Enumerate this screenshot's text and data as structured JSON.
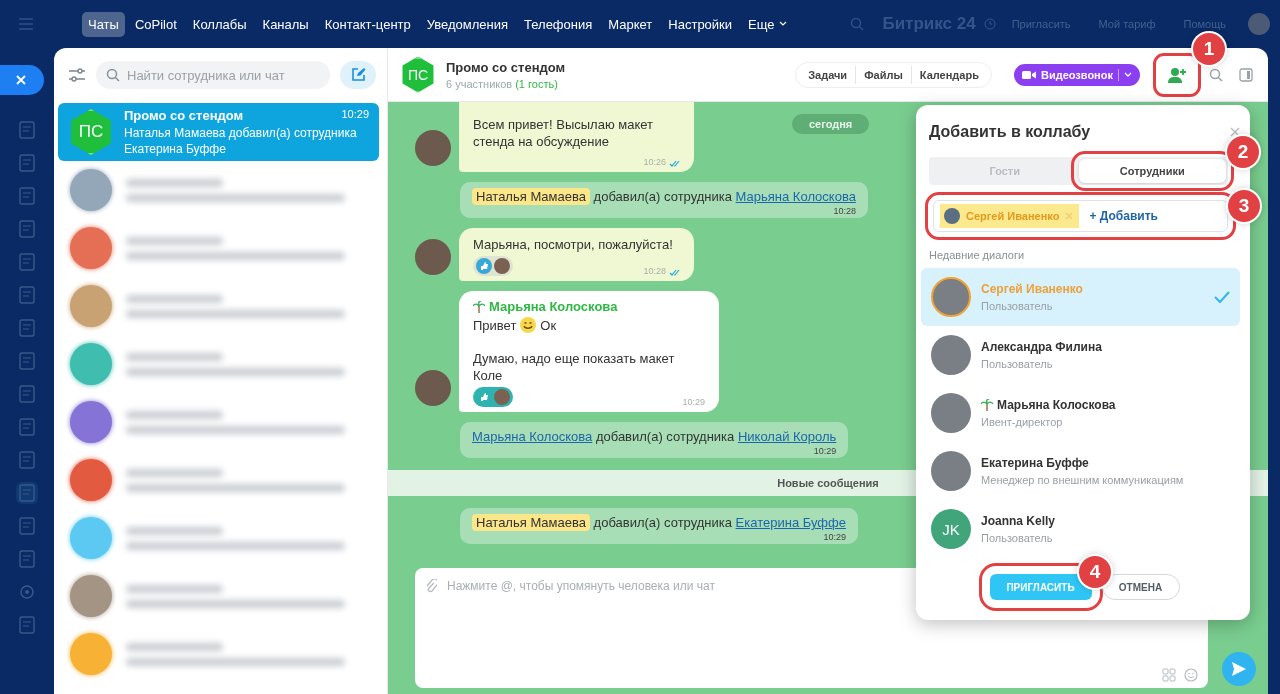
{
  "top_nav": {
    "items": [
      {
        "label": "Чаты",
        "selected": true,
        "kind": "link"
      },
      {
        "label": "CoPilot",
        "selected": false,
        "kind": "link"
      },
      {
        "label": "Коллабы",
        "selected": false,
        "kind": "link"
      },
      {
        "label": "Каналы",
        "selected": false,
        "kind": "link"
      },
      {
        "label": "Контакт-центр",
        "selected": false,
        "kind": "link"
      },
      {
        "label": "Уведомления",
        "selected": false,
        "kind": "link"
      },
      {
        "label": "Телефония",
        "selected": false,
        "kind": "link"
      },
      {
        "label": "Маркет",
        "selected": false,
        "kind": "link"
      },
      {
        "label": "Настройки",
        "selected": false,
        "kind": "link"
      },
      {
        "label": "Еще",
        "selected": false,
        "kind": "dropdown"
      }
    ],
    "brand": "Битрикс 24",
    "links": [
      "Пригласить",
      "Мой тариф",
      "Помощь"
    ]
  },
  "chat_list": {
    "search": {
      "placeholder": "Найти сотрудника или чат"
    },
    "chats": [
      {
        "kind": "chat",
        "initials": "ПС",
        "title": "Промо со стендом",
        "time": "10:29",
        "preview": "Наталья Мамаева добавил(а) сотрудника Екатерина Буффе",
        "selected": true
      },
      {
        "kind": "blurred",
        "color": "#93a7b8",
        "selected": false
      },
      {
        "kind": "blurred",
        "color": "#e46f55",
        "selected": false
      },
      {
        "kind": "blurred",
        "color": "#c9a274",
        "selected": false
      },
      {
        "kind": "blurred",
        "color": "#3fbdae",
        "selected": false
      },
      {
        "kind": "blurred",
        "color": "#8574d6",
        "selected": false
      },
      {
        "kind": "blurred",
        "color": "#e25b41",
        "selected": false
      },
      {
        "kind": "blurred",
        "color": "#5cc9f2",
        "selected": false
      },
      {
        "kind": "blurred",
        "color": "#a39484",
        "selected": false
      },
      {
        "kind": "blurred",
        "color": "#f7b236",
        "selected": false
      }
    ]
  },
  "chat": {
    "initials": "ПС",
    "title": "Промо со стендом",
    "members": "6 участников",
    "guests": "(1 гость)",
    "actions": [
      "Задачи",
      "Файлы",
      "Календарь"
    ],
    "call_button": "Видеозвонок",
    "date_pill": "сегодня",
    "messages": [
      {
        "kind": "outgoing",
        "text": "Всем привет! Высылаю макет стенда на обсуждение",
        "time": "10:26",
        "read": true
      },
      {
        "kind": "system",
        "actor": {
          "kind": "mention",
          "name": "Наталья Мамаева"
        },
        "verb": "добавил(а) сотрудника",
        "target": "Марьяна Колоскова",
        "time": "10:28"
      },
      {
        "kind": "outgoing",
        "text": "Марьяна, посмотри, пожалуйста!",
        "time": "10:28",
        "read": true,
        "reaction_mine": false
      },
      {
        "kind": "incoming",
        "author": "Марьяна Колоскова",
        "away": true,
        "greeting": "Привет",
        "greeting_tail": "Ок",
        "text": "Думаю, надо еще показать макет Коле",
        "time": "10:29",
        "read": false,
        "reaction_mine": true
      },
      {
        "kind": "system",
        "actor": {
          "kind": "link",
          "name": "Марьяна Колоскова"
        },
        "verb": "добавил(а) сотрудника",
        "target": "Николай Король",
        "time": "10:29"
      },
      {
        "kind": "divider",
        "text": "Новые сообщения"
      },
      {
        "kind": "system",
        "actor": {
          "kind": "mention",
          "name": "Наталья Мамаева"
        },
        "verb": "добавил(а) сотрудника",
        "target": "Екатерина Буффе",
        "time": "10:29"
      }
    ],
    "composer": {
      "placeholder": "Нажмите @, чтобы упомянуть человека или чат"
    }
  },
  "dialog": {
    "title": "Добавить в коллабу",
    "tabs": [
      {
        "label": "Гости",
        "selected": false
      },
      {
        "label": "Сотрудники",
        "selected": true
      }
    ],
    "chips": [
      {
        "name": "Сергей Иваненко"
      }
    ],
    "add_link": "+ Добавить",
    "section": "Недавние диалоги",
    "people": [
      {
        "kind": "photo",
        "name": "Сергей Иваненко",
        "role": "Пользователь",
        "selected": true
      },
      {
        "kind": "photo",
        "name": "Александра Филина",
        "role": "Пользователь",
        "selected": false
      },
      {
        "kind": "photo",
        "name": "Марьяна Колоскова",
        "role": "Ивент-директор",
        "selected": false,
        "away": true
      },
      {
        "kind": "photo",
        "name": "Екатерина Буффе",
        "role": "Менеджер по внешним коммуникациям",
        "selected": false
      },
      {
        "kind": "initials",
        "initials": "JK",
        "name": "Joanna Kelly",
        "role": "Пользователь",
        "selected": false
      }
    ],
    "buttons": [
      {
        "label": "ПРИГЛАСИТЬ",
        "kind": "primary"
      },
      {
        "label": "ОТМЕНА",
        "kind": "secondary"
      }
    ]
  },
  "annotations": [
    {
      "label": "1"
    },
    {
      "label": "2"
    },
    {
      "label": "3"
    },
    {
      "label": "4"
    }
  ]
}
